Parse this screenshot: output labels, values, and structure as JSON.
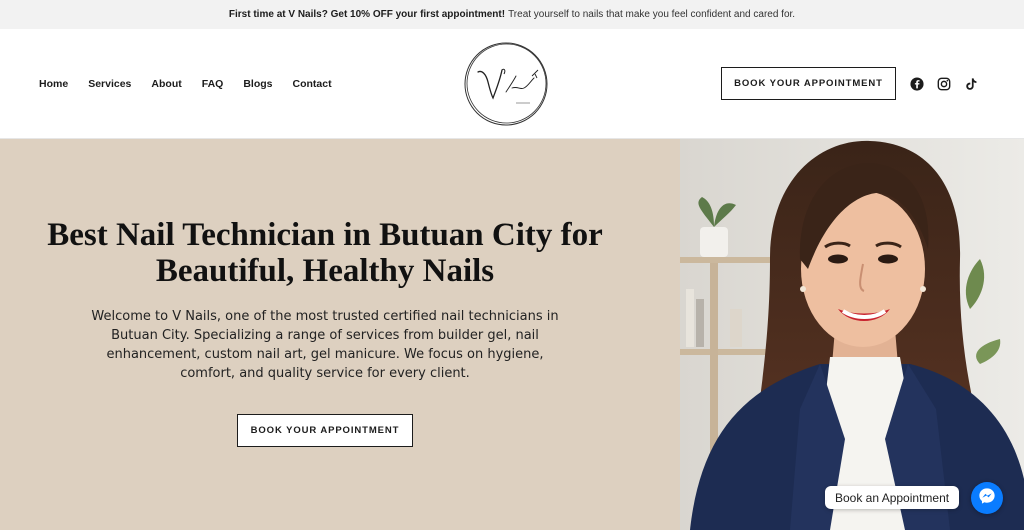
{
  "promo": {
    "bold": "First time at V Nails? Get 10% OFF your first appointment!",
    "text": "Treat yourself to nails that make you feel confident and cared for."
  },
  "nav": {
    "items": [
      "Home",
      "Services",
      "About",
      "FAQ",
      "Blogs",
      "Contact"
    ]
  },
  "header": {
    "cta_label": "BOOK YOUR APPOINTMENT",
    "social_icons": [
      "facebook-icon",
      "instagram-icon",
      "tiktok-icon"
    ]
  },
  "hero": {
    "title": "Best Nail Technician in Butuan City for Beautiful, Healthy Nails",
    "description": "Welcome to V Nails, one of the most trusted certified nail technicians in Butuan City. Specializing a range of services from builder gel, nail enhancement, custom nail art, gel manicure. We focus on hygiene, comfort, and quality service for every client.",
    "cta_label": "BOOK YOUR APPOINTMENT",
    "background_color": "#ddd0c0"
  },
  "chat": {
    "label": "Book an Appointment",
    "icon": "messenger-icon",
    "color": "#0a7cff"
  }
}
